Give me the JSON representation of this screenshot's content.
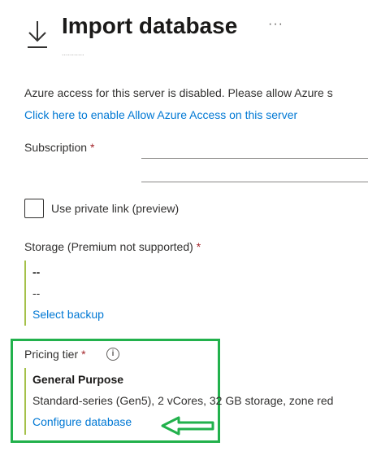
{
  "header": {
    "title": "Import database",
    "icon": "download-icon",
    "more_label": "···",
    "subtitle": "..........."
  },
  "notice": {
    "text": "Azure access for this server is disabled. Please allow Azure s",
    "link": "Click here to enable Allow Azure Access on this server"
  },
  "subscription": {
    "label": "Subscription",
    "required": "*"
  },
  "private_link": {
    "label": "Use private link (preview)",
    "checked": false
  },
  "storage": {
    "label": "Storage (Premium not supported)",
    "required": "*",
    "value_primary": "--",
    "value_secondary": "--",
    "link": "Select backup"
  },
  "pricing": {
    "label": "Pricing tier",
    "required": "*",
    "info_glyph": "i",
    "tier_name": "General Purpose",
    "tier_description": "Standard-series (Gen5), 2 vCores, 32 GB storage, zone red",
    "link": "Configure database"
  },
  "annotations": {
    "highlight_color": "#22b14c",
    "accent_bar_color": "#a5c14a",
    "link_color": "#0078d4",
    "required_color": "#a4262c"
  }
}
